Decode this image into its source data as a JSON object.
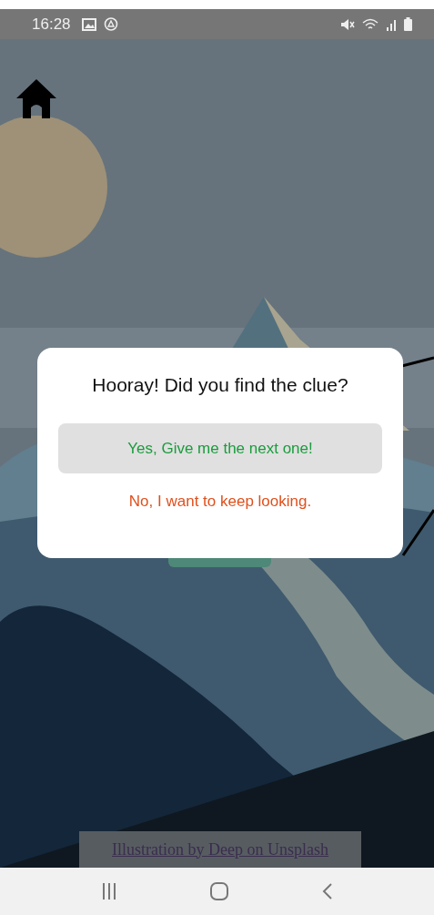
{
  "status_bar": {
    "time": "16:28"
  },
  "dialog": {
    "title": "Hooray! Did you find the clue?",
    "buttons": [
      {
        "label": "Yes, Give me the next one!",
        "kind": "confirm"
      },
      {
        "label": "No, I want to keep looking.",
        "kind": "cancel"
      }
    ]
  },
  "credit": {
    "link": "Illustration by Deep on Unsplash"
  }
}
